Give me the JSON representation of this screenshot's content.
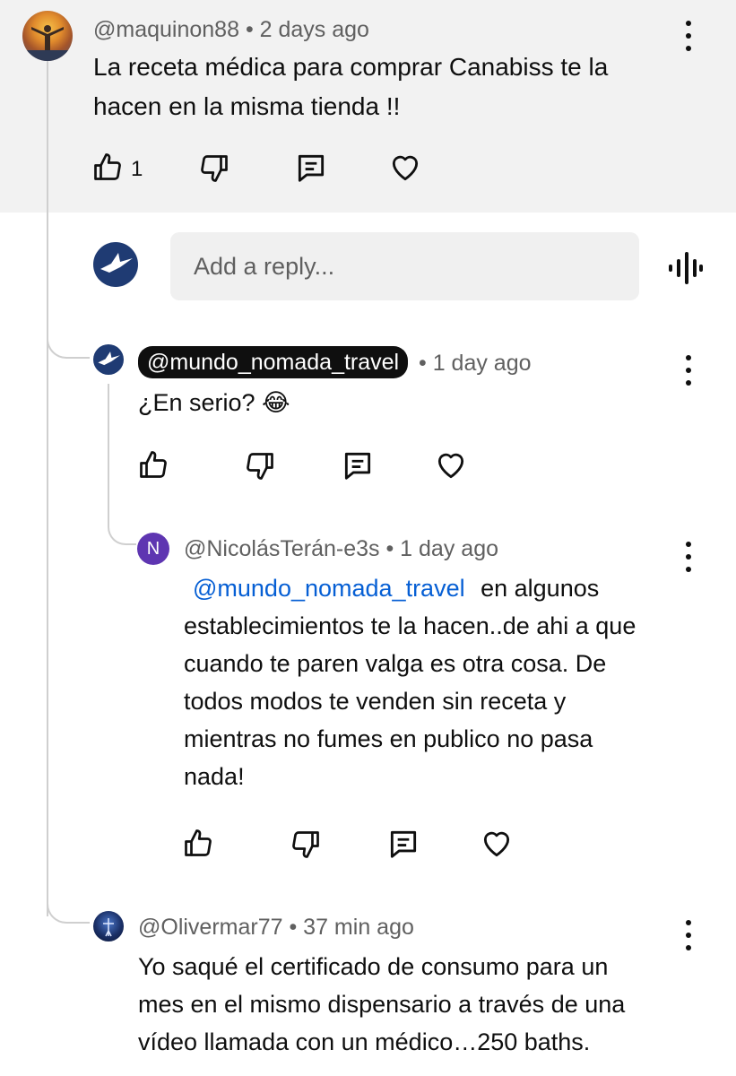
{
  "comments": [
    {
      "handle": "@maquinon88",
      "time": "• 2 days ago",
      "text_lines": [
        "La receta médica para comprar Canabiss te la",
        "hacen en la misma tienda !!"
      ],
      "like_count": "1"
    },
    {
      "handle": "@mundo_nomada_travel",
      "time": "• 1 day ago",
      "text": "¿En serio? 😂"
    },
    {
      "handle": "@NicolásTerán-e3s",
      "avatar_letter": "N",
      "time": "• 1 day ago",
      "mention": "@mundo_nomada_travel",
      "text_first": "en algunos",
      "text_lines": [
        "establecimientos te la hacen..de ahi a que",
        "cuando te paren valga es otra cosa. De",
        "todos modos te venden sin receta y",
        "mientras no fumes en publico no pasa",
        "nada!"
      ]
    },
    {
      "handle": "@Olivermar77",
      "time": "• 37 min ago",
      "text_lines": [
        "Yo saqué el certificado de consumo para un",
        "mes en el mismo dispensario a través de una",
        "vídeo llamada con un médico…250 baths."
      ]
    }
  ],
  "reply": {
    "placeholder": "Add a reply..."
  },
  "colors": {
    "band": "#f2f2f2",
    "mention": "#065fd4",
    "avatar_n": "#5e35b1"
  },
  "icons": [
    "thumb-up-icon",
    "thumb-down-icon",
    "reply-icon",
    "heart-icon",
    "more-vert-icon",
    "voice-search-icon"
  ]
}
